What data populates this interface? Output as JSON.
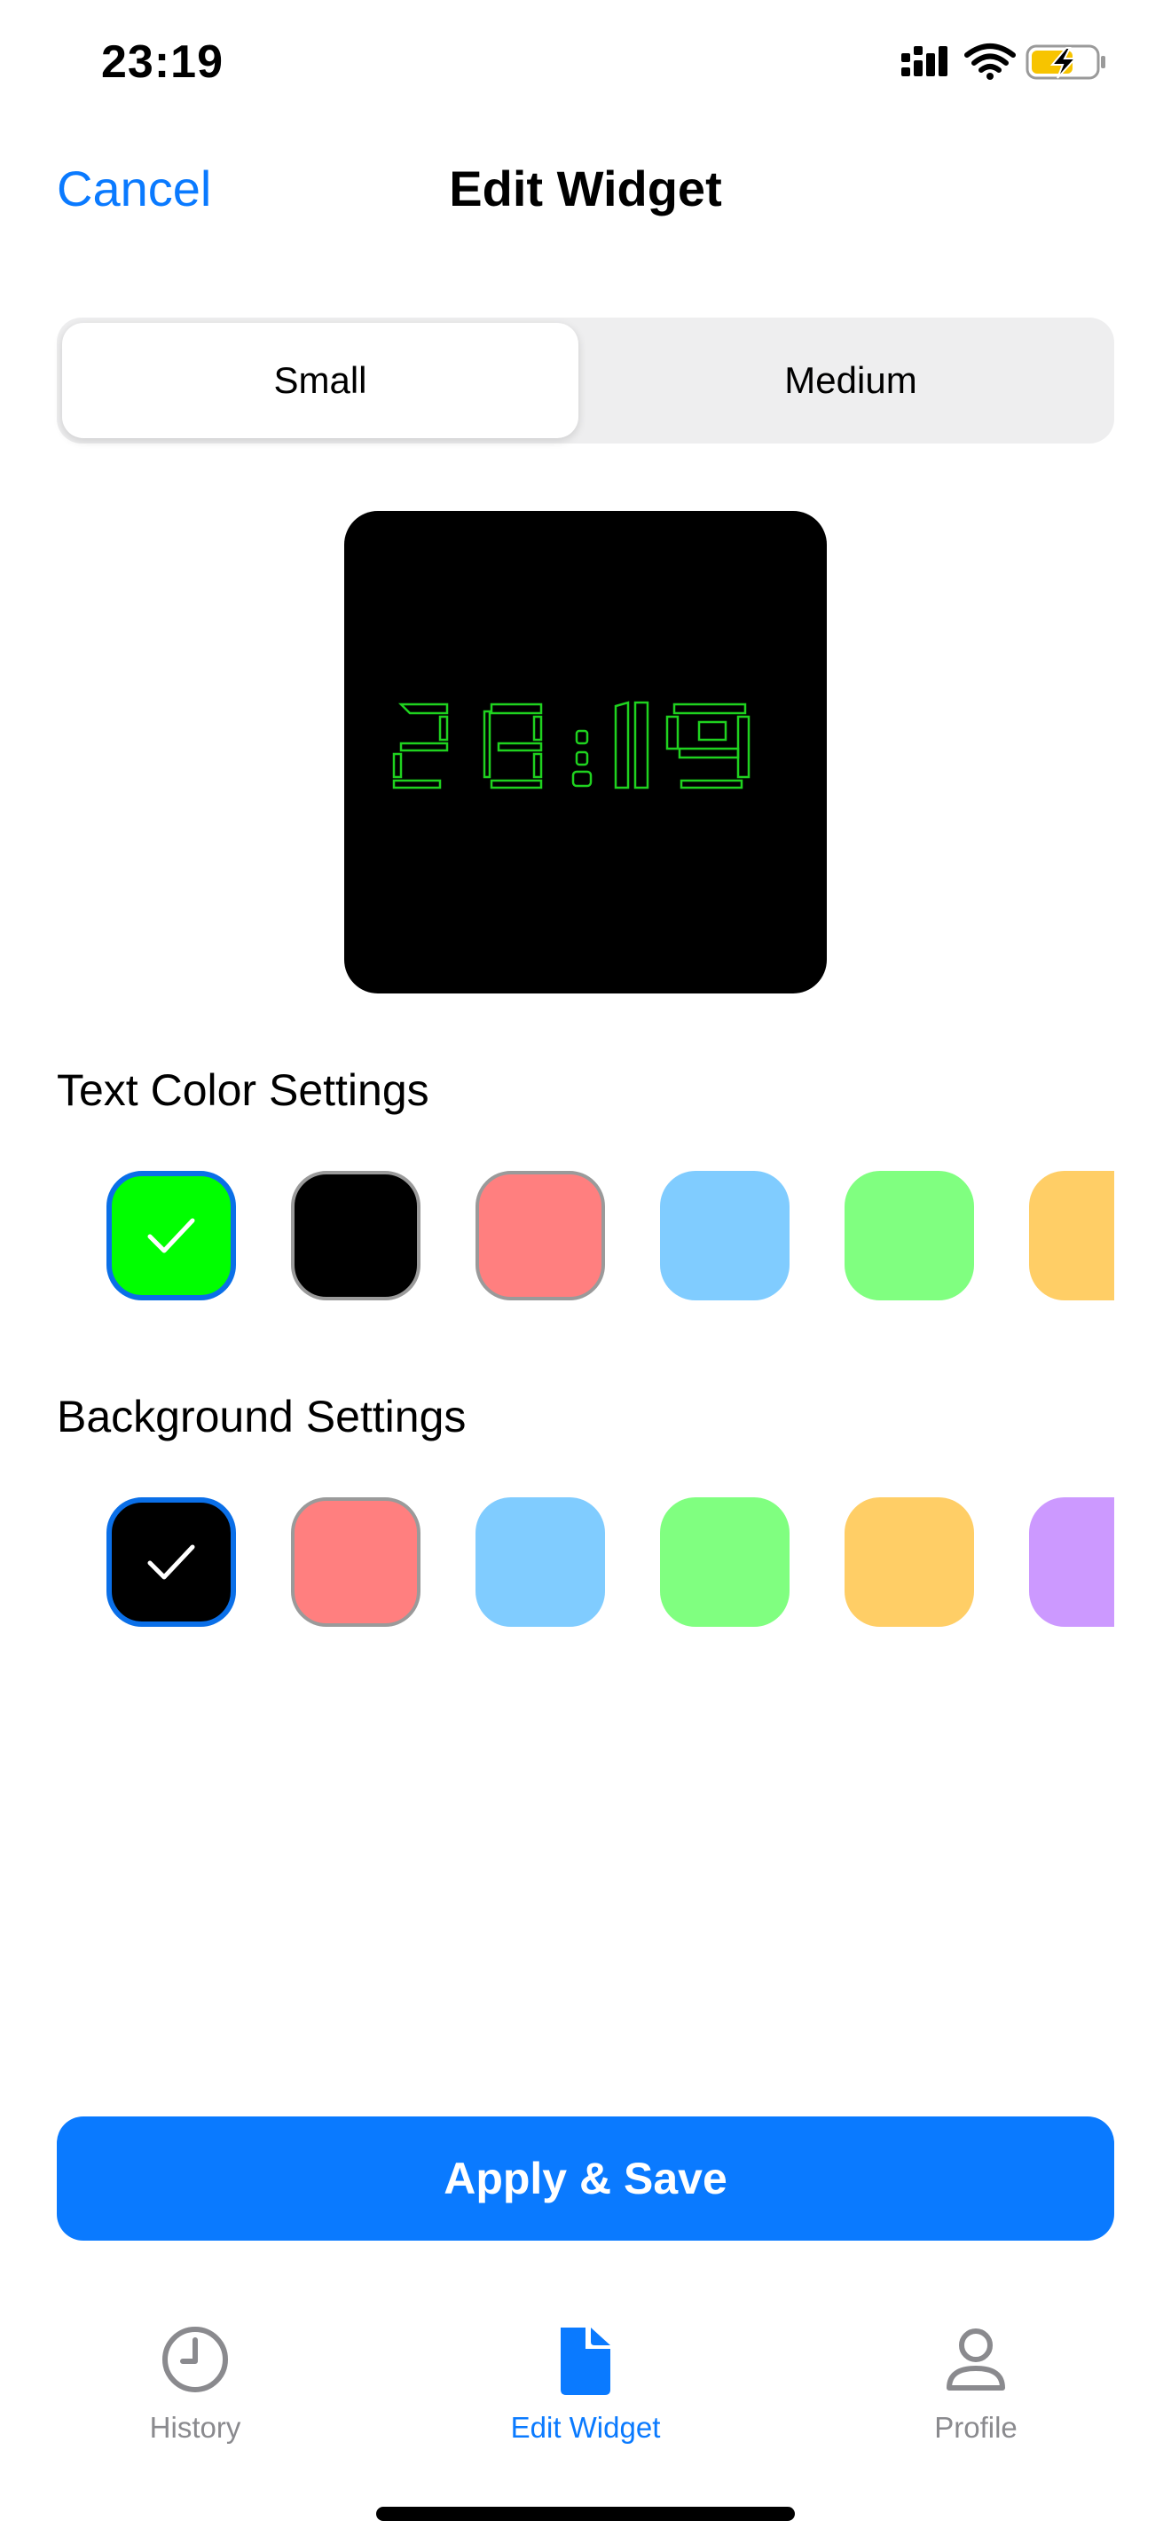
{
  "status_bar": {
    "time": "23:19"
  },
  "nav": {
    "cancel_label": "Cancel",
    "title": "Edit Widget"
  },
  "segments": {
    "small_label": "Small",
    "medium_label": "Medium",
    "selected": "Small"
  },
  "widget_preview": {
    "time_text": "23:19",
    "text_color": "#1fd21f",
    "background": "#000000"
  },
  "text_color_section": {
    "title": "Text Color Settings",
    "swatches": [
      {
        "color": "#00ff00",
        "selected": true
      },
      {
        "color": "#000000",
        "selected": false
      },
      {
        "color": "#ff7f7f",
        "selected": false
      },
      {
        "color": "#80ccff",
        "selected": false
      },
      {
        "color": "#80ff80",
        "selected": false
      },
      {
        "color": "#ffce66",
        "selected": false
      }
    ]
  },
  "background_section": {
    "title": "Background Settings",
    "swatches": [
      {
        "color": "#000000",
        "selected": true
      },
      {
        "color": "#ff7f7f",
        "selected": false
      },
      {
        "color": "#80ccff",
        "selected": false
      },
      {
        "color": "#80ff80",
        "selected": false
      },
      {
        "color": "#ffce66",
        "selected": false
      },
      {
        "color": "#cc99ff",
        "selected": false
      }
    ]
  },
  "apply_button": {
    "label": "Apply & Save"
  },
  "tab_bar": {
    "history_label": "History",
    "edit_widget_label": "Edit Widget",
    "profile_label": "Profile",
    "active": "Edit Widget"
  },
  "colors": {
    "accent": "#0a7aff",
    "inactive_tab": "#8a8a8e"
  }
}
